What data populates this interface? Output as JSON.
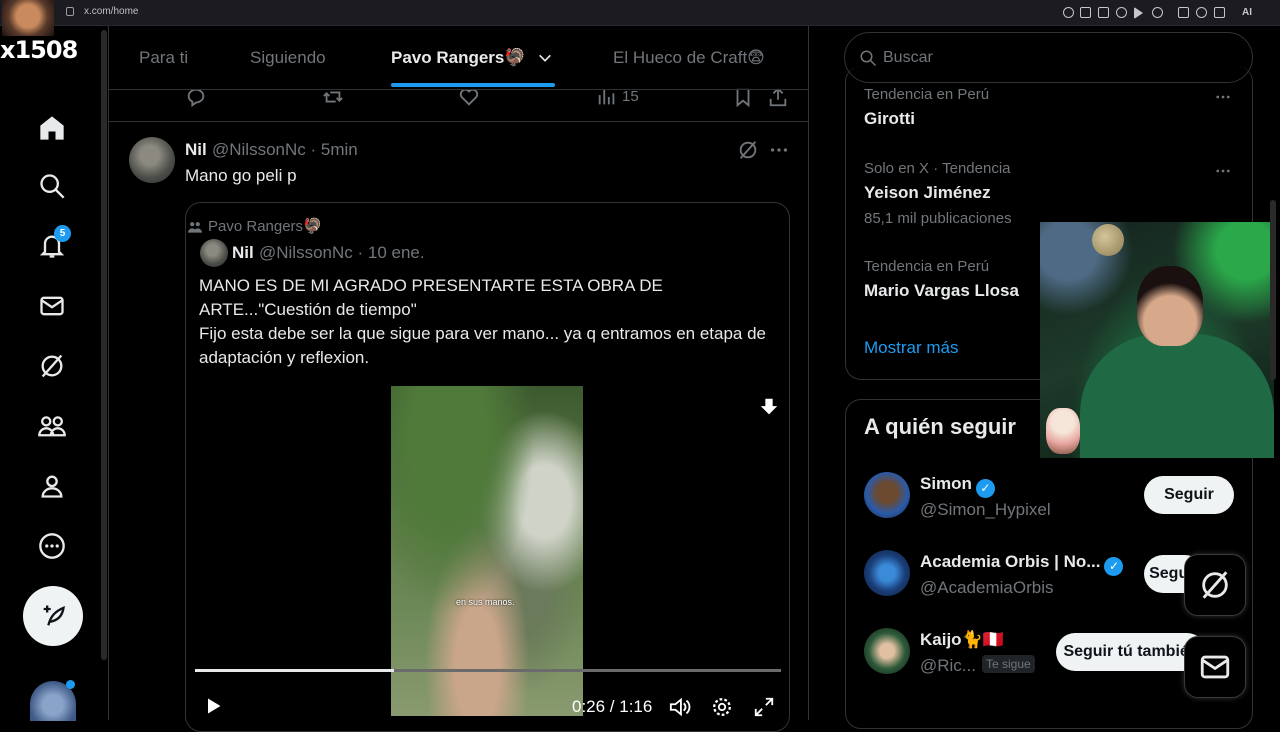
{
  "browser": {
    "url": "x.com/home",
    "ai_label": "AI"
  },
  "overlay": {
    "streamer_tag": "x1508"
  },
  "nav": {
    "notifications_badge": "5"
  },
  "tabs": [
    {
      "label": "Para ti"
    },
    {
      "label": "Siguiendo"
    },
    {
      "label": "Pavo Rangers🦃"
    },
    {
      "label": "El Hueco de Craft😨"
    }
  ],
  "prev_tweet": {
    "views": "15"
  },
  "tweet": {
    "name": "Nil",
    "handle": "@NilssonNc · 5min",
    "text": "Mano go peli p",
    "quote": {
      "community": "Pavo Rangers🦃",
      "name": "Nil",
      "handle": "@NilssonNc · 10 ene.",
      "text": "MANO ES DE MI AGRADO PRESENTARTE ESTA OBRA DE ARTE...\"Cuestión de tiempo\"\nFijo esta debe ser la que sigue para ver mano... ya q entramos en etapa de adaptación y reflexion.",
      "video_caption": "en sus manos.",
      "time": "0:26 / 1:16",
      "progress": 0.34
    }
  },
  "search": {
    "placeholder": "Buscar"
  },
  "trends": [
    {
      "meta": "Tendencia en Perú",
      "title": "Girotti",
      "count": ""
    },
    {
      "meta": "Solo en X · Tendencia",
      "title": "Yeison Jiménez",
      "count": "85,1 mil publicaciones"
    },
    {
      "meta": "Tendencia en Perú",
      "title": "Mario Vargas Llosa",
      "count": ""
    }
  ],
  "show_more": "Mostrar más",
  "who_to_follow": {
    "title": "A quién seguir",
    "users": [
      {
        "name": "Simon",
        "handle": "@Simon_Hypixel",
        "button": "Seguir"
      },
      {
        "name": "Academia Orbis | No...",
        "handle": "@AcademiaOrbis",
        "button": "Seguir"
      },
      {
        "name": "Kaijo🐈🇵🇪",
        "handle": "@Ric...",
        "follows_you": "Te sigue",
        "button": "Seguir tú también"
      }
    ]
  },
  "colors": {
    "accent": "#1d9bf0",
    "background": "#000000",
    "text": "#e7e9ea",
    "muted": "#71767b",
    "border": "#2f3336"
  }
}
